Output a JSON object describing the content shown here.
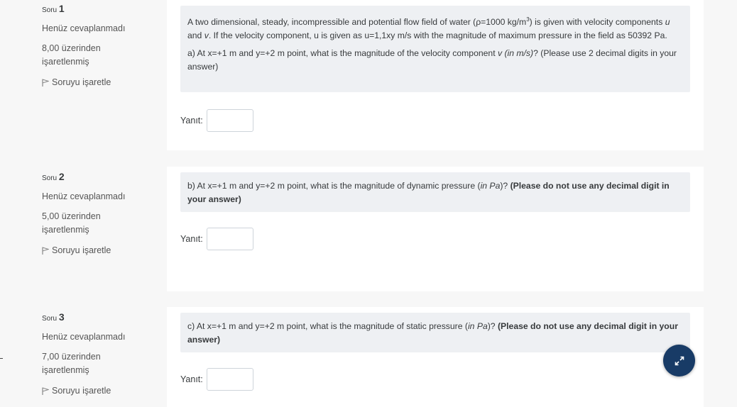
{
  "questions": [
    {
      "label": "Soru",
      "number": "1",
      "state": "Henüz cevaplanmadı",
      "grade_line1": "8,00 üzerinden",
      "grade_line2": "işaretlenmiş",
      "flag_label": "Soruyu işaretle",
      "text_p1_pre": "A two dimensional, steady, incompressible and potential flow field of water (ρ=1000 kg/m",
      "text_p1_sup": "3",
      "text_p1_mid1": ") is given with velocity components ",
      "text_p1_u": "u",
      "text_p1_and": " and ",
      "text_p1_v": "v",
      "text_p1_post": ". If the velocity component, u is given as u=1,1xy  m/s  with the magnitude of maximum pressure in the field as 50392 Pa.",
      "text_p2_pre": "a) At x=+1 m and y=+2 m point, what is the magnitude of the velocity component ",
      "text_p2_em": "v (in m/s)",
      "text_p2_post": "? (Please use 2 decimal digits in your answer)",
      "answer_label": "Yanıt:",
      "answer_value": ""
    },
    {
      "label": "Soru",
      "number": "2",
      "state": "Henüz cevaplanmadı",
      "grade_line1": "5,00 üzerinden",
      "grade_line2": "işaretlenmiş",
      "flag_label": "Soruyu işaretle",
      "text_pre": "b) At x=+1 m and y=+2 m point, what is the magnitude of dynamic pressure  (",
      "text_em": "in Pa",
      "text_post_plain": ")? ",
      "text_bold": "(Please do not use any decimal digit in your answer)",
      "answer_label": "Yanıt:",
      "answer_value": ""
    },
    {
      "label": "Soru",
      "number": "3",
      "state": "Henüz cevaplanmadı",
      "grade_line1": "7,00 üzerinden",
      "grade_line2": "işaretlenmiş",
      "flag_label": "Soruyu işaretle",
      "text_pre": "c) At x=+1 m and y=+2 m point, what is the magnitude of static pressure (",
      "text_em": "in Pa",
      "text_post_plain": ")? ",
      "text_bold": "(Please do not use any decimal digit in your answer)",
      "answer_label": "Yanıt:",
      "answer_value": ""
    }
  ],
  "fab_icon": "expand-arrows-icon",
  "colors": {
    "page_bg": "#f7f7f7",
    "text_bg": "#eef0f3",
    "fab_bg": "#183b66"
  }
}
